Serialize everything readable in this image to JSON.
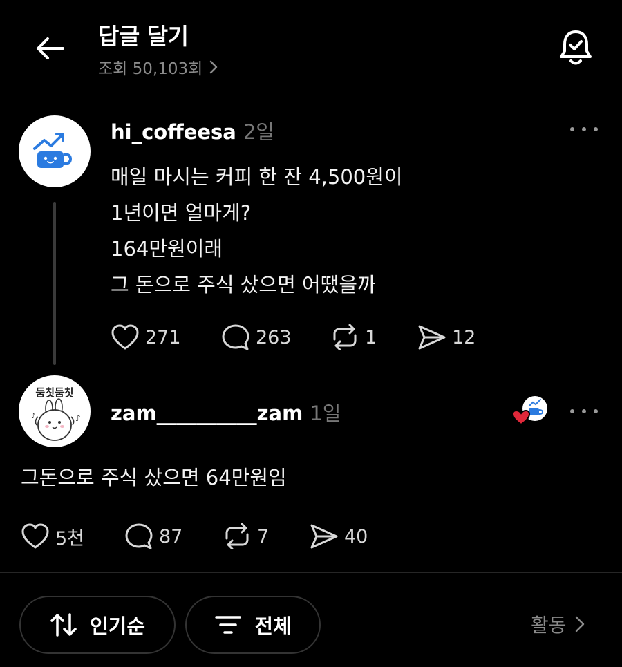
{
  "header": {
    "title": "답글 달기",
    "views_text": "조회 50,103회"
  },
  "post": {
    "username": "hi_coffeesa",
    "time": "2일",
    "lines": [
      "매일 마시는 커피 한 잔 4,500원이",
      "1년이면 얼마게?",
      "164만원이래",
      "그 돈으로 주식 샀으면 어땠을까"
    ],
    "likes": "271",
    "comments": "263",
    "reposts": "1",
    "shares": "12"
  },
  "reply": {
    "username": "zam__________zam",
    "time": "1일",
    "avatar_text": "둠칫둠칫",
    "text": "그돈으로 주식 샀으면 64만원임",
    "likes": "5천",
    "comments": "87",
    "reposts": "7",
    "shares": "40"
  },
  "footer": {
    "sort_label": "인기순",
    "filter_label": "전체",
    "activity_label": "활동"
  },
  "colors": {
    "background": "#000000",
    "brand_blue": "#2b7be0",
    "heart_red": "#e0283a"
  }
}
